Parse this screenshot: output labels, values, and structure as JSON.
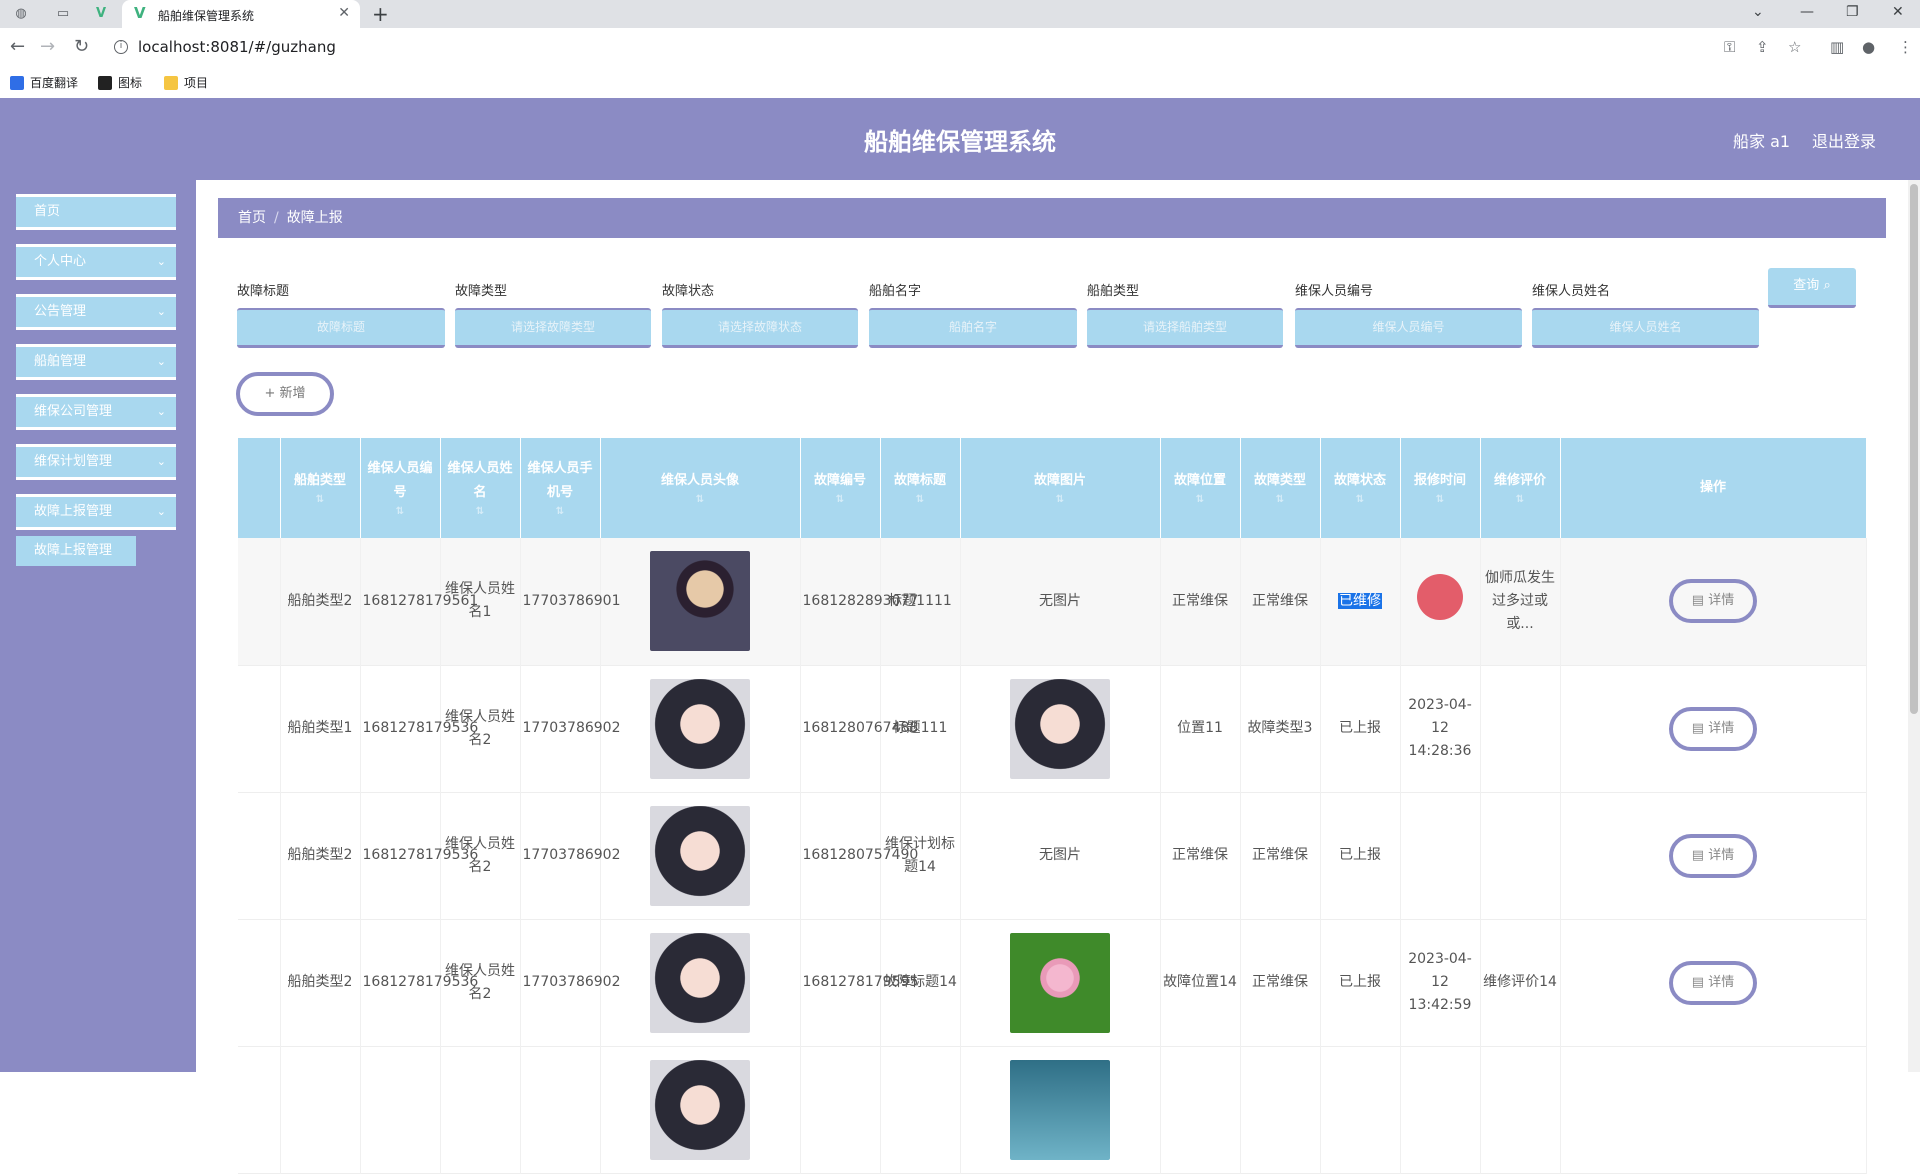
{
  "browser": {
    "tab_title": "船舶维保管理系统",
    "url": "localhost:8081/#/guzhang",
    "bookmarks": [
      "百度翻译",
      "图标",
      "项目"
    ]
  },
  "header": {
    "title": "船舶维保管理系统",
    "user": "船家 a1",
    "logout": "退出登录"
  },
  "sidebar": {
    "items": [
      {
        "label": "首页"
      },
      {
        "label": "个人中心"
      },
      {
        "label": "公告管理"
      },
      {
        "label": "船舶管理"
      },
      {
        "label": "维保公司管理"
      },
      {
        "label": "维保计划管理"
      },
      {
        "label": "故障上报管理"
      }
    ],
    "sub_item": "故障上报管理"
  },
  "breadcrumb": {
    "home": "首页",
    "current": "故障上报"
  },
  "filters": [
    {
      "label": "故障标题",
      "placeholder": "故障标题"
    },
    {
      "label": "故障类型",
      "placeholder": "请选择故障类型"
    },
    {
      "label": "故障状态",
      "placeholder": "请选择故障状态"
    },
    {
      "label": "船舶名字",
      "placeholder": "船舶名字"
    },
    {
      "label": "船舶类型",
      "placeholder": "请选择船舶类型"
    },
    {
      "label": "维保人员编号",
      "placeholder": "维保人员编号"
    },
    {
      "label": "维保人员姓名",
      "placeholder": "维保人员姓名"
    }
  ],
  "buttons": {
    "query": "查询",
    "add": "新增",
    "detail": "详情"
  },
  "table": {
    "headers": [
      "船舶类型",
      "维保人员编号",
      "维保人员姓名",
      "维保人员手机号",
      "维保人员头像",
      "故障编号",
      "故障标题",
      "故障图片",
      "故障位置",
      "故障类型",
      "故障状态",
      "报修时间",
      "维修评价",
      "操作"
    ],
    "rows": [
      {
        "ship_type": "船舶类型2",
        "staff_no": "1681278179561",
        "staff_name": "维保人员姓名1",
        "phone": "17703786901",
        "avatar": "man",
        "fault_no": "1681282893077",
        "fault_title": "标题1111",
        "fault_img": "无图片",
        "location": "正常维保",
        "fault_type": "正常维保",
        "status": "已维修",
        "time": "",
        "review": "伽师瓜发生过多过或或..."
      },
      {
        "ship_type": "船舶类型1",
        "staff_no": "1681278179536",
        "staff_name": "维保人员姓名2",
        "phone": "17703786902",
        "avatar": "girl",
        "fault_no": "1681280767488",
        "fault_title": "标题111",
        "fault_img": "girl",
        "location": "位置11",
        "fault_type": "故障类型3",
        "status": "已上报",
        "time": "2023-04-12 14:28:36",
        "review": ""
      },
      {
        "ship_type": "船舶类型2",
        "staff_no": "1681278179536",
        "staff_name": "维保人员姓名2",
        "phone": "17703786902",
        "avatar": "girl",
        "fault_no": "1681280757490",
        "fault_title": "维保计划标题14",
        "fault_img": "无图片",
        "location": "正常维保",
        "fault_type": "正常维保",
        "status": "已上报",
        "time": "",
        "review": ""
      },
      {
        "ship_type": "船舶类型2",
        "staff_no": "1681278179536",
        "staff_name": "维保人员姓名2",
        "phone": "17703786902",
        "avatar": "girl",
        "fault_no": "1681278179595",
        "fault_title": "故障标题14",
        "fault_img": "lotus",
        "location": "故障位置14",
        "fault_type": "正常维保",
        "status": "已上报",
        "time": "2023-04-12 13:42:59",
        "review": "维修评价14"
      }
    ]
  }
}
